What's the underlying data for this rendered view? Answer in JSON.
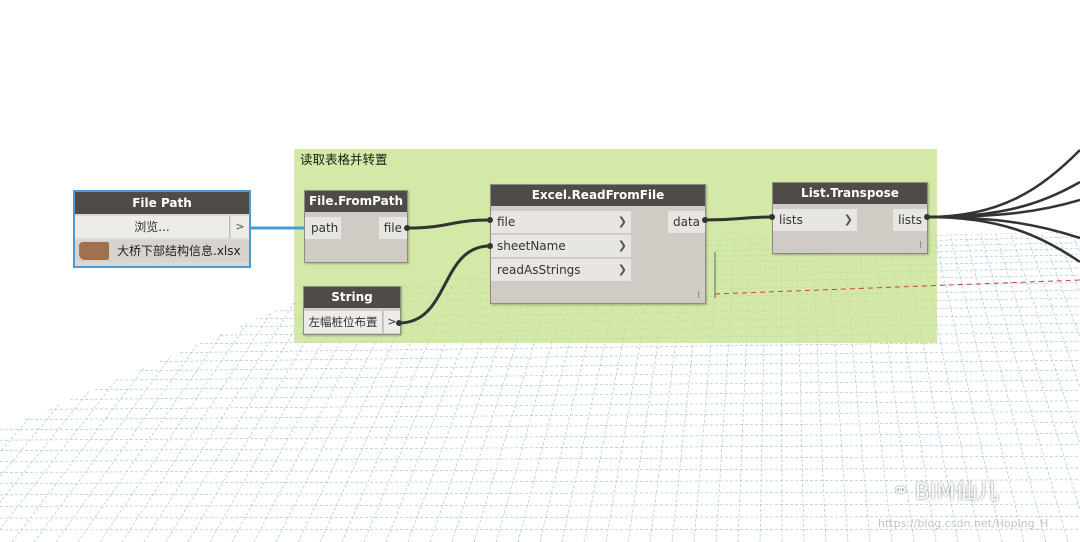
{
  "group": {
    "title": "读取表格并转置"
  },
  "nodes": {
    "file_path": {
      "title": "File Path",
      "browse_label": "浏览...",
      "output_symbol": ">",
      "file_name": "大桥下部结构信息.xlsx"
    },
    "file_from_path": {
      "title": "File.FromPath",
      "input": "path",
      "output": "file"
    },
    "string": {
      "title": "String",
      "value": "左幅桩位布置",
      "output_symbol": ">"
    },
    "excel_read": {
      "title": "Excel.ReadFromFile",
      "inputs": [
        "file",
        "sheetName",
        "readAsStrings"
      ],
      "output": "data",
      "arrow": "❯",
      "lacing": "l"
    },
    "list_transpose": {
      "title": "List.Transpose",
      "input": "lists",
      "output": "lists",
      "arrow": "❯",
      "lacing": "l"
    }
  },
  "watermark": {
    "icon": "wechat-icon",
    "label": "BIM仙儿",
    "url": "https://blog.csdn.net/Hoping_H"
  },
  "colors": {
    "group": "#c4e086",
    "node_header": "#4e4b48",
    "selection": "#4a9ad6",
    "wire": "#333333",
    "grid": "#9cc0d8",
    "dashed_line": "#d04040"
  }
}
